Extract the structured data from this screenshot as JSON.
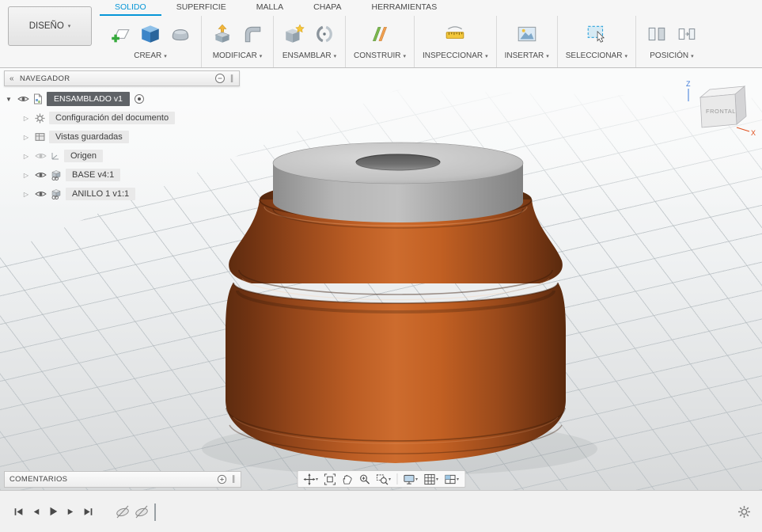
{
  "design_menu": {
    "label": "DISEÑO"
  },
  "ui": {
    "caret": "▾",
    "grip": "∥",
    "collapse": "«",
    "tri_open": "▼",
    "tri_closed": "▷"
  },
  "tabs": [
    {
      "label": "SOLIDO",
      "active": true
    },
    {
      "label": "SUPERFICIE",
      "active": false
    },
    {
      "label": "MALLA",
      "active": false
    },
    {
      "label": "CHAPA",
      "active": false
    },
    {
      "label": "HERRAMIENTAS",
      "active": false
    }
  ],
  "toolbar_groups": [
    {
      "label": "CREAR"
    },
    {
      "label": "MODIFICAR"
    },
    {
      "label": "ENSAMBLAR"
    },
    {
      "label": "CONSTRUIR"
    },
    {
      "label": "INSPECCIONAR"
    },
    {
      "label": "INSERTAR"
    },
    {
      "label": "SELECCIONAR"
    },
    {
      "label": "POSICIÓN"
    }
  ],
  "navigator": {
    "title": "NAVEGADOR",
    "root_label": "ENSAMBLADO v1",
    "items": [
      {
        "label": "Configuración del documento"
      },
      {
        "label": "Vistas guardadas"
      },
      {
        "label": "Origen"
      },
      {
        "label": "BASE v4:1"
      },
      {
        "label": "ANILLO 1 v1:1"
      }
    ]
  },
  "viewcube": {
    "face": "FRONTAL",
    "axis_z": "Z",
    "axis_x": "X"
  },
  "comments": {
    "title": "COMENTARIOS"
  },
  "colors": {
    "accent": "#0696D7",
    "copper": "#C4632A",
    "copper_dark": "#5E2C10",
    "part_gray": "#B5B5B5",
    "grid_line": "#C9CED1"
  }
}
